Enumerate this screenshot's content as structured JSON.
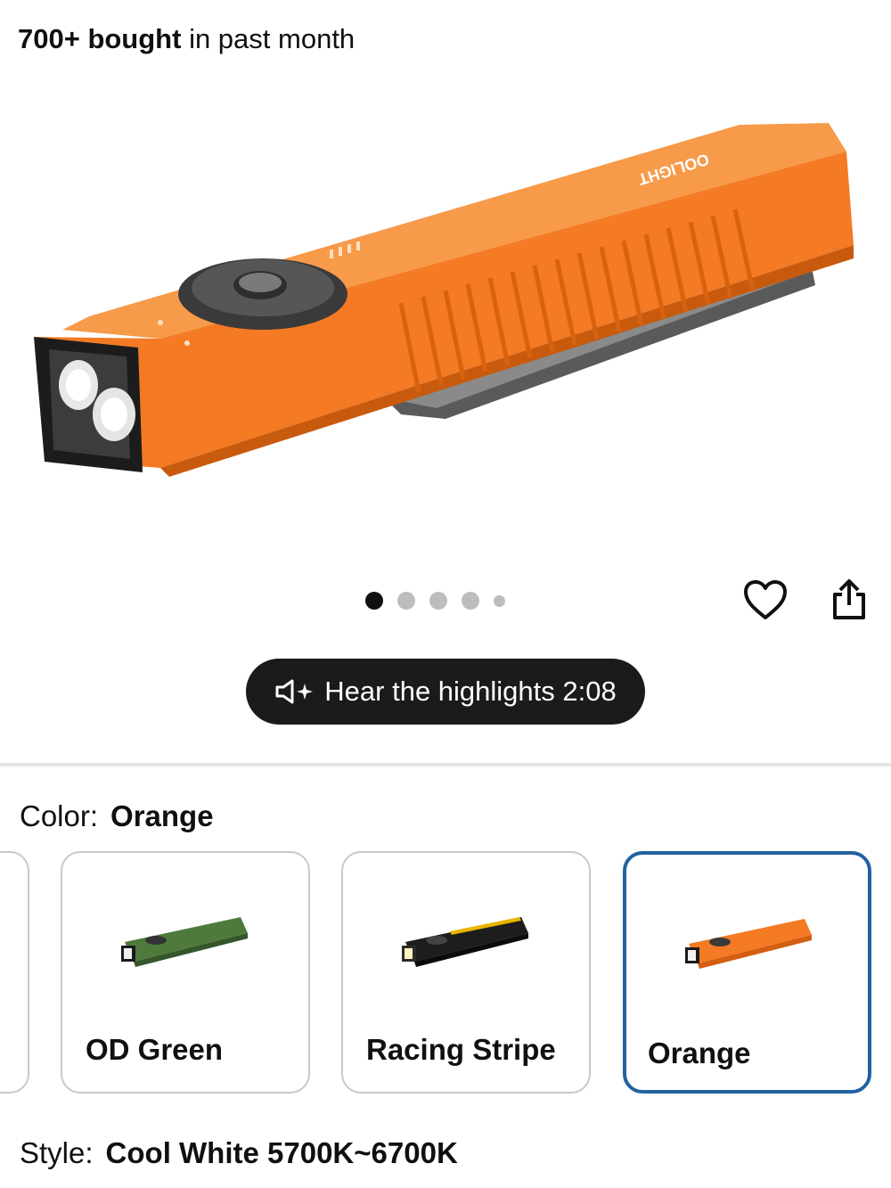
{
  "purchase": {
    "count": "700+ bought",
    "suffix": " in past month"
  },
  "product": {
    "image_icon": "orange-flashlight-image",
    "brand_mark": "OOLIGHT"
  },
  "carousel": {
    "total": 5,
    "active": 0
  },
  "actions": {
    "wishlist_icon": "heart-icon",
    "share_icon": "share-icon"
  },
  "audio": {
    "label": "Hear the highlights 2:08",
    "icon": "speaker-sparkle-icon"
  },
  "color": {
    "label": "Color:",
    "selected": "Orange",
    "options": [
      {
        "label": "OD Green",
        "body": "#4f7a3c",
        "dark": "#35552a"
      },
      {
        "label": "Racing Stripe",
        "body": "#1d1d1d",
        "dark": "#0c0c0c",
        "stripe": "#e8b400"
      },
      {
        "label": "Orange",
        "body": "#f47a24",
        "dark": "#d35e10"
      }
    ]
  },
  "style": {
    "label": "Style:",
    "selected": "Cool White 5700K~6700K"
  },
  "colors": {
    "accent_border": "#2162a1",
    "hero_orange": "#f47a24",
    "pill": "#1b1b1b"
  }
}
